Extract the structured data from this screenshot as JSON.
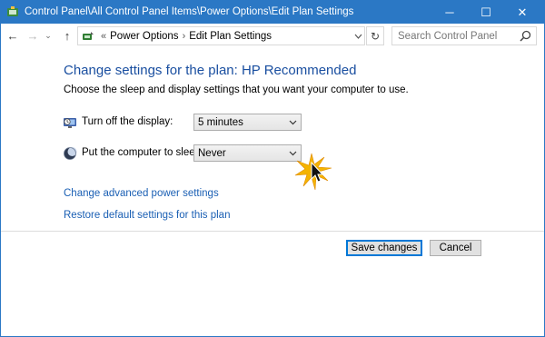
{
  "window": {
    "title": "Control Panel\\All Control Panel Items\\Power Options\\Edit Plan Settings",
    "controls": {
      "minimize": "─",
      "maximize": "☐",
      "close": "✕"
    }
  },
  "nav": {
    "back_icon": "←",
    "forward_icon": "→",
    "history_icon": "⌄",
    "up_icon": "↑",
    "breadcrumb_prefix": "«",
    "breadcrumbs": [
      "Power Options",
      "Edit Plan Settings"
    ],
    "breadcrumb_separator": "›",
    "refresh_icon": "↻",
    "search_placeholder": "Search Control Panel"
  },
  "content": {
    "heading": "Change settings for the plan: HP Recommended",
    "subtext": "Choose the sleep and display settings that you want your computer to use.",
    "settings": [
      {
        "label": "Turn off the display:",
        "value": "5 minutes",
        "icon": "monitor-clock-icon"
      },
      {
        "label": "Put the computer to sleep:",
        "value": "Never",
        "icon": "moon-icon"
      }
    ],
    "links": {
      "advanced": "Change advanced power settings",
      "restore": "Restore default settings for this plan"
    }
  },
  "footer": {
    "save_label": "Save changes",
    "cancel_label": "Cancel"
  },
  "colors": {
    "titlebar": "#2b78c5",
    "heading": "#1a4fa0",
    "link": "#1a5fb4",
    "accent_button": "#0078d7"
  }
}
